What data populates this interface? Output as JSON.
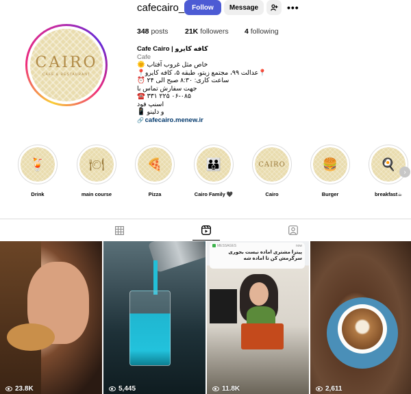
{
  "profile": {
    "username": "cafecairo_",
    "follow_label": "Follow",
    "message_label": "Message",
    "logo_text": "CAIRO",
    "logo_sub": "CAFE & RESTAURANT",
    "stats": {
      "posts_count": "348",
      "posts_label": "posts",
      "followers_count": "21K",
      "followers_label": "followers",
      "following_count": "4",
      "following_label": "following"
    },
    "bio": {
      "name": "Cafe Cairo | کافه کایرو",
      "category": "Cafe",
      "lines": [
        "خاص مثل غروب آفتاب 🌞",
        "📍عدالت ۹۹، مجتمع زیتو، طبقه ۵، کافه کایرو📍",
        "ساعت کاری: ۸:۳۰ صبح الی ۲۴ ⏰",
        "جهت سفارش تماس با",
        "☎️ ۳۳۱ ۲۲۵ ۰۶-۰۸۵",
        "اسنپ فود",
        "و دلینو 📱"
      ],
      "link": "cafecairo.menew.ir"
    }
  },
  "highlights": [
    {
      "label": "Drink",
      "icon": "drink-icon",
      "glyph": "🍹"
    },
    {
      "label": "main course",
      "icon": "cutlery-icon",
      "glyph": "🍽"
    },
    {
      "label": "Pizza",
      "icon": "pizza-icon",
      "glyph": "🍕"
    },
    {
      "label": "Cairo Family 🖤",
      "icon": "family-icon",
      "glyph": "👪"
    },
    {
      "label": "Cairo",
      "icon": "cairo-logo-icon",
      "glyph": "CAIRO"
    },
    {
      "label": "Burger",
      "icon": "burger-icon",
      "glyph": "🍔"
    },
    {
      "label": "breakfast☕",
      "icon": "breakfast-icon",
      "glyph": "🍳"
    }
  ],
  "tabs": [
    {
      "name": "posts-tab",
      "icon": "grid-icon",
      "active": false
    },
    {
      "name": "reels-tab",
      "icon": "reels-icon",
      "active": true
    },
    {
      "name": "tagged-tab",
      "icon": "tagged-icon",
      "active": false
    }
  ],
  "reels": [
    {
      "views": "23.8K"
    },
    {
      "views": "5,445"
    },
    {
      "views": "11.8K",
      "message_app": "MESSAGES",
      "message_time": "now",
      "message_text": "پیتزا مشتری اماده نیست بجوری سرگرمش کن تا اماده شه"
    },
    {
      "views": "2,611"
    }
  ],
  "colors": {
    "follow_button": "#4c5bd4",
    "link": "#00376b",
    "highlight_bg": "#e9dcae"
  }
}
